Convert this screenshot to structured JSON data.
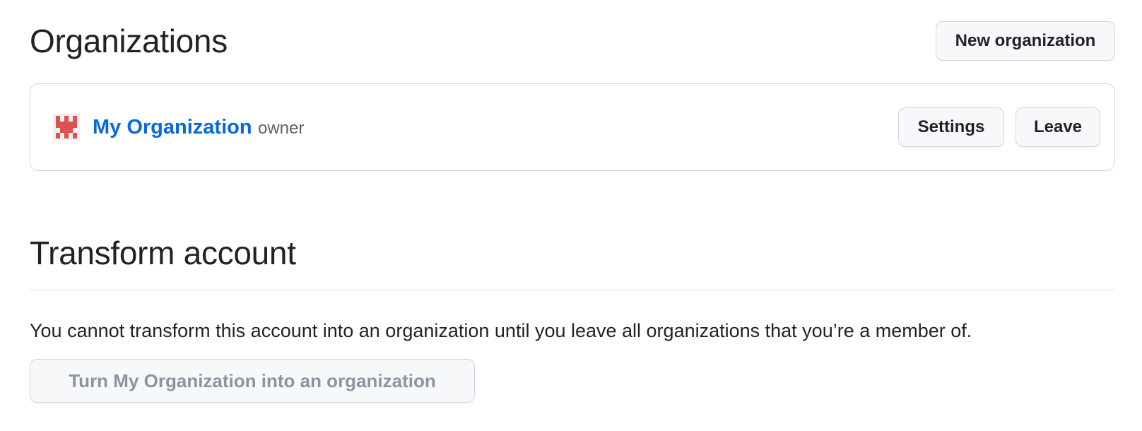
{
  "organizations": {
    "title": "Organizations",
    "new_button_label": "New organization",
    "items": [
      {
        "name": "My Organization",
        "role": "owner",
        "avatar_icon": "identicon-icon",
        "avatar_color": "#d9534f",
        "settings_label": "Settings",
        "leave_label": "Leave"
      }
    ]
  },
  "transform": {
    "title": "Transform account",
    "description": "You cannot transform this account into an organization until you leave all organizations that you’re a member of.",
    "button_label": "Turn My Organization into an organization",
    "button_disabled": true
  },
  "colors": {
    "link": "#0969da",
    "text": "#1f2328",
    "muted": "#59636e",
    "border": "#d0d7de",
    "button_bg": "#f6f8fa",
    "disabled_text": "#8c959f"
  }
}
